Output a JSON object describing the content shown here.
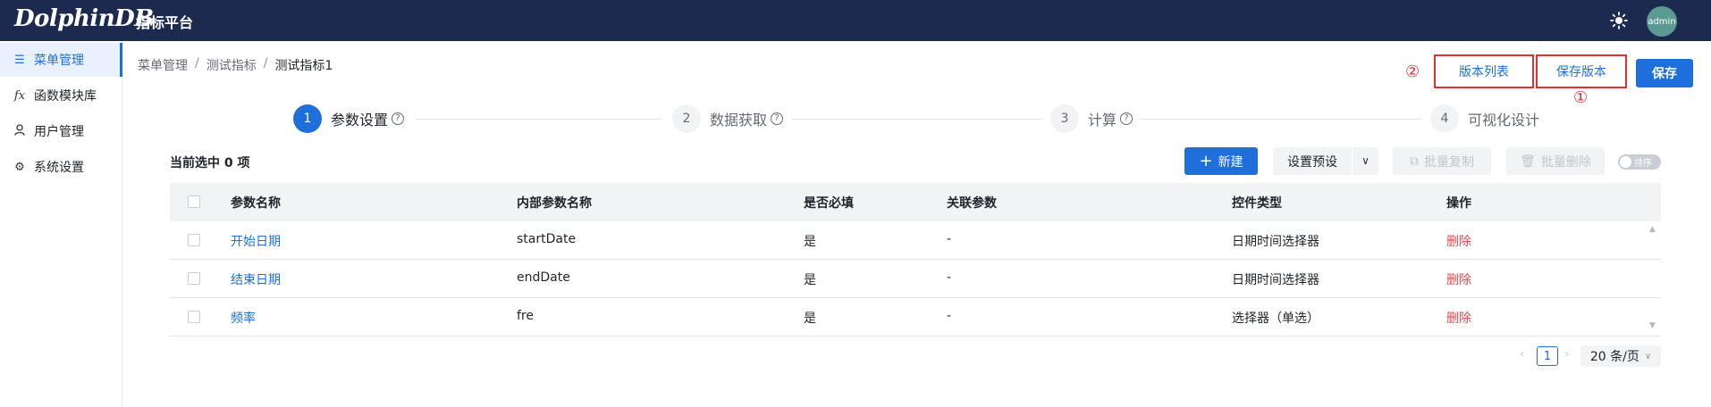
{
  "app": {
    "logo": "DolphinDB",
    "title": "指标平台",
    "user": "admin"
  },
  "sidebar": {
    "items": [
      {
        "label": "菜单管理",
        "icon": "menu-icon",
        "active": true
      },
      {
        "label": "函数模块库",
        "icon": "function-icon",
        "active": false
      },
      {
        "label": "用户管理",
        "icon": "user-icon",
        "active": false
      },
      {
        "label": "系统设置",
        "icon": "gear-icon",
        "active": false
      }
    ]
  },
  "breadcrumb": [
    "菜单管理",
    "测试指标",
    "测试指标1"
  ],
  "actions": {
    "version_list": "版本列表",
    "save_version": "保存版本",
    "save": "保存",
    "marker_1": "①",
    "marker_2": "②"
  },
  "steps": [
    {
      "num": "1",
      "label": "参数设置",
      "help": true,
      "active": true
    },
    {
      "num": "2",
      "label": "数据获取",
      "help": true,
      "active": false
    },
    {
      "num": "3",
      "label": "计算",
      "help": true,
      "active": false
    },
    {
      "num": "4",
      "label": "可视化设计",
      "help": false,
      "active": false
    }
  ],
  "toolbar": {
    "selected": "当前选中 0 项",
    "new": "新建",
    "preset": "设置预设",
    "batch_copy": "批量复制",
    "batch_delete": "批量删除",
    "sort_toggle": "排序"
  },
  "table": {
    "columns": [
      "参数名称",
      "内部参数名称",
      "是否必填",
      "关联参数",
      "控件类型",
      "操作"
    ],
    "rows": [
      [
        "开始日期",
        "startDate",
        "是",
        "-",
        "日期时间选择器",
        "删除"
      ],
      [
        "结束日期",
        "endDate",
        "是",
        "-",
        "日期时间选择器",
        "删除"
      ],
      [
        "频率",
        "fre",
        "是",
        "-",
        "选择器（单选）",
        "删除"
      ]
    ]
  },
  "pagination": {
    "current": "1",
    "page_size": "20 条/页"
  },
  "colors": {
    "header_bg": "#1b2a4e",
    "primary": "#1e6fdb",
    "danger": "#e5484d",
    "annotation": "#e03131"
  }
}
